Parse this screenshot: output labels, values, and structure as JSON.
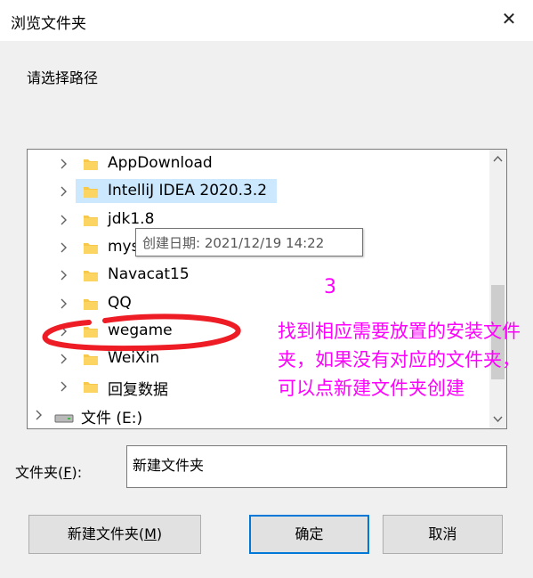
{
  "window": {
    "title": "浏览文件夹",
    "close_symbol": "✕"
  },
  "prompt": "请选择路径",
  "tree": {
    "items": [
      {
        "label": "AppDownload",
        "selected": false
      },
      {
        "label": "IntelliJ IDEA 2020.3.2",
        "selected": true
      },
      {
        "label": "jdk1.8",
        "selected": false
      },
      {
        "label": "mys",
        "selected": false
      },
      {
        "label": "Navacat15",
        "selected": false
      },
      {
        "label": "QQ",
        "selected": false
      },
      {
        "label": "wegame",
        "selected": false
      },
      {
        "label": "WeiXin",
        "selected": false
      },
      {
        "label": "回复数据",
        "selected": false
      }
    ],
    "drive": {
      "label": "文件 (E:)"
    }
  },
  "tooltip": "创建日期: 2021/12/19 14:22",
  "annotation": {
    "number": "3",
    "text": "找到相应需要放置的安装文件夹，如果没有对应的文件夹，可以点新建文件夹创建",
    "color": "#ff00ff",
    "circle_color": "#ee1c25"
  },
  "folder_field": {
    "label": "文件夹(",
    "hotkey": "F",
    "label_end": "):",
    "value": "新建文件夹"
  },
  "buttons": {
    "new_folder": {
      "label": "新建文件夹(",
      "hotkey": "M",
      "label_end": ")"
    },
    "ok": "确定",
    "cancel": "取消"
  },
  "colors": {
    "selection": "#cce8ff",
    "folder": "#f8c84a",
    "primary_border": "#0078d7"
  }
}
